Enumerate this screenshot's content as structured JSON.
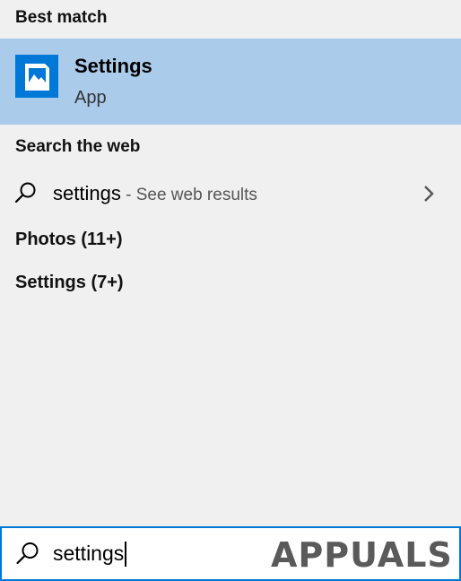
{
  "best_match": {
    "header": "Best match",
    "item": {
      "title": "Settings",
      "subtitle": "App",
      "icon": "settings-app-icon"
    }
  },
  "search_web": {
    "header": "Search the web",
    "query": "settings",
    "suffix": " - See web results",
    "icon": "search-icon",
    "chevron": "chevron-right-icon"
  },
  "categories": [
    {
      "label": "Photos (11+)"
    },
    {
      "label": "Settings (7+)"
    }
  ],
  "search_box": {
    "value": "settings",
    "icon": "search-icon"
  },
  "watermark": {
    "text": "APPUALS"
  },
  "colors": {
    "panel_bg": "#f0f0f0",
    "selected_bg": "#aacbea",
    "accent": "#0078d7"
  }
}
